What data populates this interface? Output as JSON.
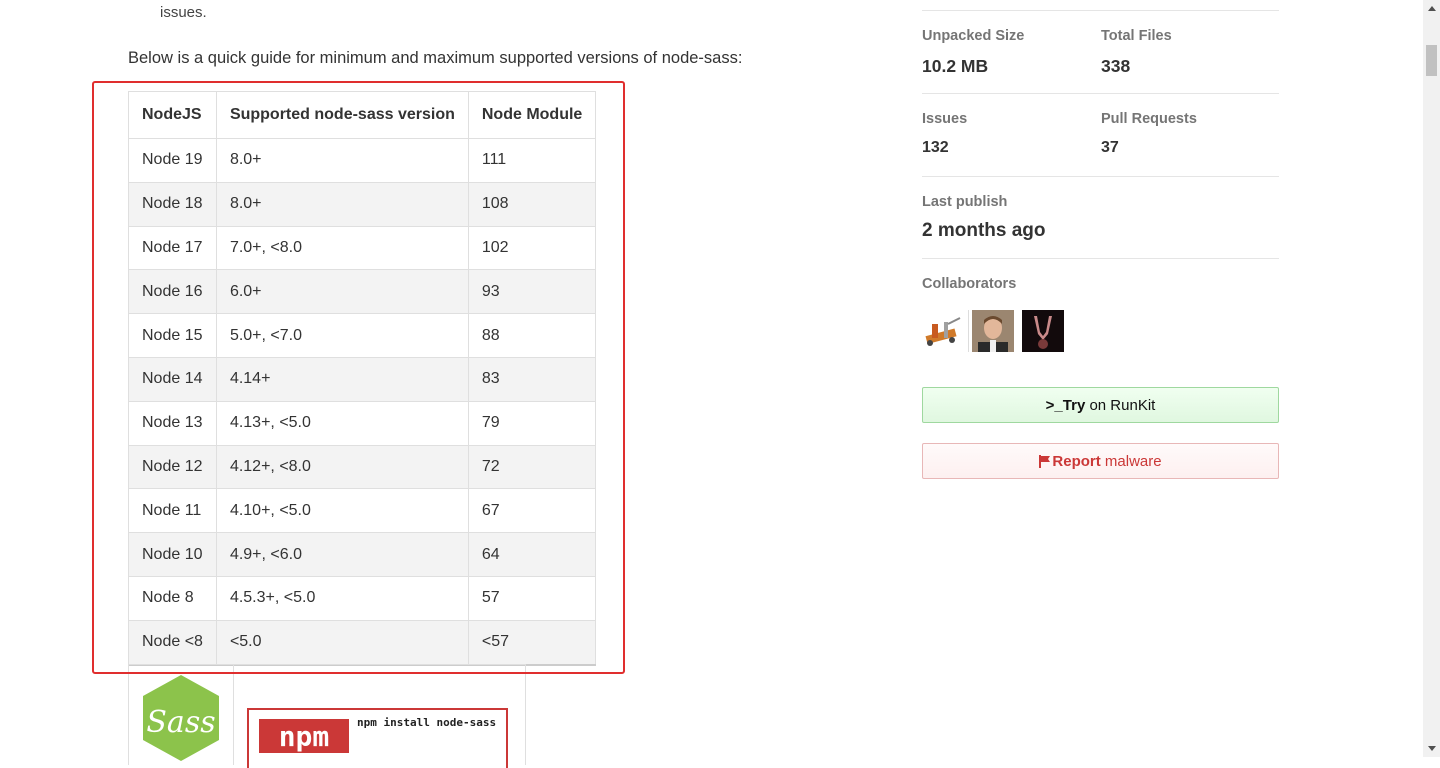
{
  "readme": {
    "prev_line": "issues.",
    "intro": "Below is a quick guide for minimum and maximum supported versions of node-sass:",
    "table": {
      "headers": [
        "NodeJS",
        "Supported node-sass version",
        "Node Module"
      ],
      "rows": [
        [
          "Node 19",
          "8.0+",
          "111"
        ],
        [
          "Node 18",
          "8.0+",
          "108"
        ],
        [
          "Node 17",
          "7.0+, <8.0",
          "102"
        ],
        [
          "Node 16",
          "6.0+",
          "93"
        ],
        [
          "Node 15",
          "5.0+, <7.0",
          "88"
        ],
        [
          "Node 14",
          "4.14+",
          "83"
        ],
        [
          "Node 13",
          "4.13+, <5.0",
          "79"
        ],
        [
          "Node 12",
          "4.12+, <8.0",
          "72"
        ],
        [
          "Node 11",
          "4.10+, <5.0",
          "67"
        ],
        [
          "Node 10",
          "4.9+, <6.0",
          "64"
        ],
        [
          "Node 8",
          "4.5.3+, <5.0",
          "57"
        ],
        [
          "Node <8",
          "<5.0",
          "<57"
        ]
      ]
    },
    "badges": {
      "sass_logo_text": "Sass",
      "npm_logo_text": "npm",
      "npm_command": "npm install node-sass"
    }
  },
  "sidebar": {
    "unpacked_size": {
      "label": "Unpacked Size",
      "value": "10.2 MB"
    },
    "total_files": {
      "label": "Total Files",
      "value": "338"
    },
    "issues": {
      "label": "Issues",
      "value": "132"
    },
    "pull_requests": {
      "label": "Pull Requests",
      "value": "37"
    },
    "last_publish": {
      "label": "Last publish",
      "value": "2 months ago"
    },
    "collaborators": {
      "label": "Collaborators",
      "count": 3
    },
    "runkit": {
      "prefix": ">_",
      "bold": "Try",
      "rest": " on RunKit"
    },
    "report": {
      "bold": "Report",
      "rest": " malware"
    }
  },
  "colors": {
    "highlight": "#e02e2e",
    "npm_red": "#cb3837",
    "sass_green": "#8cc34b",
    "runkit_green": "#e0f7e0"
  },
  "icons": [
    "flag-icon",
    "scroll-up-icon",
    "scroll-down-icon"
  ]
}
